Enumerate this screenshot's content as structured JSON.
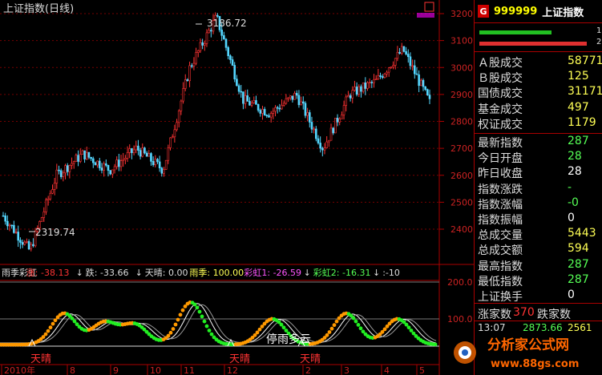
{
  "chart": {
    "title": "上证指数(日线)",
    "price_axis": [
      "3200",
      "3100",
      "3000",
      "2900",
      "2800",
      "2700",
      "2600",
      "2500",
      "2400"
    ],
    "indicator_axis": [
      "200.0",
      "100.0"
    ],
    "date_labels": [
      "2010年",
      "8",
      "9",
      "10",
      "11",
      "12",
      "2",
      "3",
      "4",
      "5"
    ],
    "high_label": "3186.72",
    "low_label": "2319.74",
    "indicator_header": [
      {
        "text": "雨季彩虹",
        "color": "#dddddd"
      },
      {
        "text": "涨: -38.13",
        "color": "#ff3333"
      },
      {
        "text": "↓",
        "color": "#dddddd"
      },
      {
        "text": "跌: -33.66",
        "color": "#dddddd"
      },
      {
        "text": "↓",
        "color": "#dddddd"
      },
      {
        "text": "天晴: 0.00",
        "color": "#dddddd"
      },
      {
        "text": "雨季: 100.00",
        "color": "#ffff55"
      },
      {
        "text": "彩虹1: -26.59",
        "color": "#ff55ff"
      },
      {
        "text": "↓",
        "color": "#dddddd"
      },
      {
        "text": "彩虹2: -16.31",
        "color": "#55ff55"
      },
      {
        "text": "↓",
        "color": "#dddddd"
      },
      {
        "text": ":-10",
        "color": "#dddddd"
      }
    ],
    "annotations": {
      "sunny": "天晴",
      "rain": "停雨多云"
    }
  },
  "chart_data": {
    "type": "candlestick",
    "title": "上证指数(日线)",
    "y_range": [
      2250,
      3250
    ],
    "points": [
      {
        "date": "2010-07",
        "price": 2450
      },
      {
        "date": "2010-07",
        "price": 2319.74
      },
      {
        "date": "2010-08",
        "price": 2600
      },
      {
        "date": "2010-08",
        "price": 2680
      },
      {
        "date": "2010-09",
        "price": 2620
      },
      {
        "date": "2010-09",
        "price": 2700
      },
      {
        "date": "2010-10",
        "price": 2620
      },
      {
        "date": "2010-10",
        "price": 3000
      },
      {
        "date": "2010-11",
        "price": 3186.72
      },
      {
        "date": "2010-11",
        "price": 2880
      },
      {
        "date": "2010-12",
        "price": 2830
      },
      {
        "date": "2010-12",
        "price": 2900
      },
      {
        "date": "2011-01",
        "price": 2700
      },
      {
        "date": "2011-02",
        "price": 2900
      },
      {
        "date": "2011-03",
        "price": 2950
      },
      {
        "date": "2011-04",
        "price": 3067
      },
      {
        "date": "2011-05",
        "price": 2870
      }
    ],
    "indicator": {
      "y_range": [
        0,
        200
      ],
      "reference_levels": [
        100,
        0
      ]
    }
  },
  "panel": {
    "code": "999999",
    "name": "上证指数",
    "badge": "G",
    "bar_right_1": "1",
    "bar_right_2": "2",
    "rows_top": [
      {
        "label": "Ａ股成交",
        "value": "58771",
        "color": "#ffff55"
      },
      {
        "label": "Ｂ股成交",
        "value": "125",
        "color": "#ffff55"
      },
      {
        "label": "国债成交",
        "value": "31171",
        "color": "#ffff55"
      },
      {
        "label": "基金成交",
        "value": "497",
        "color": "#ffff55"
      },
      {
        "label": "权证成交",
        "value": "1179",
        "color": "#ffff55"
      }
    ],
    "rows_mid": [
      {
        "label": "最新指数",
        "value": "287",
        "color": "#55ff55"
      },
      {
        "label": "今日开盘",
        "value": "28",
        "color": "#55ff55"
      },
      {
        "label": "昨日收盘",
        "value": "28",
        "color": "#ffffff"
      },
      {
        "label": "指数涨跌",
        "value": "-",
        "color": "#55ff55"
      },
      {
        "label": "指数涨幅",
        "value": "-0",
        "color": "#55ff55"
      },
      {
        "label": "指数振幅",
        "value": "0",
        "color": "#ffffff"
      },
      {
        "label": "总成交量",
        "value": "5443",
        "color": "#ffff55"
      },
      {
        "label": "总成交额",
        "value": "594",
        "color": "#ffff55"
      },
      {
        "label": "最高指数",
        "value": "287",
        "color": "#55ff55"
      },
      {
        "label": "最低指数",
        "value": "287",
        "color": "#55ff55"
      },
      {
        "label": "上证换手",
        "value": "0",
        "color": "#ffffff"
      }
    ],
    "adv_label": "涨家数",
    "adv_value": "370",
    "dec_label": "跌家数",
    "tick_time": "13:07",
    "tick_price": "2873.66",
    "tick_vol": "2561"
  },
  "watermark": {
    "text": "分析家公式网",
    "url": "www.88gs.com"
  }
}
